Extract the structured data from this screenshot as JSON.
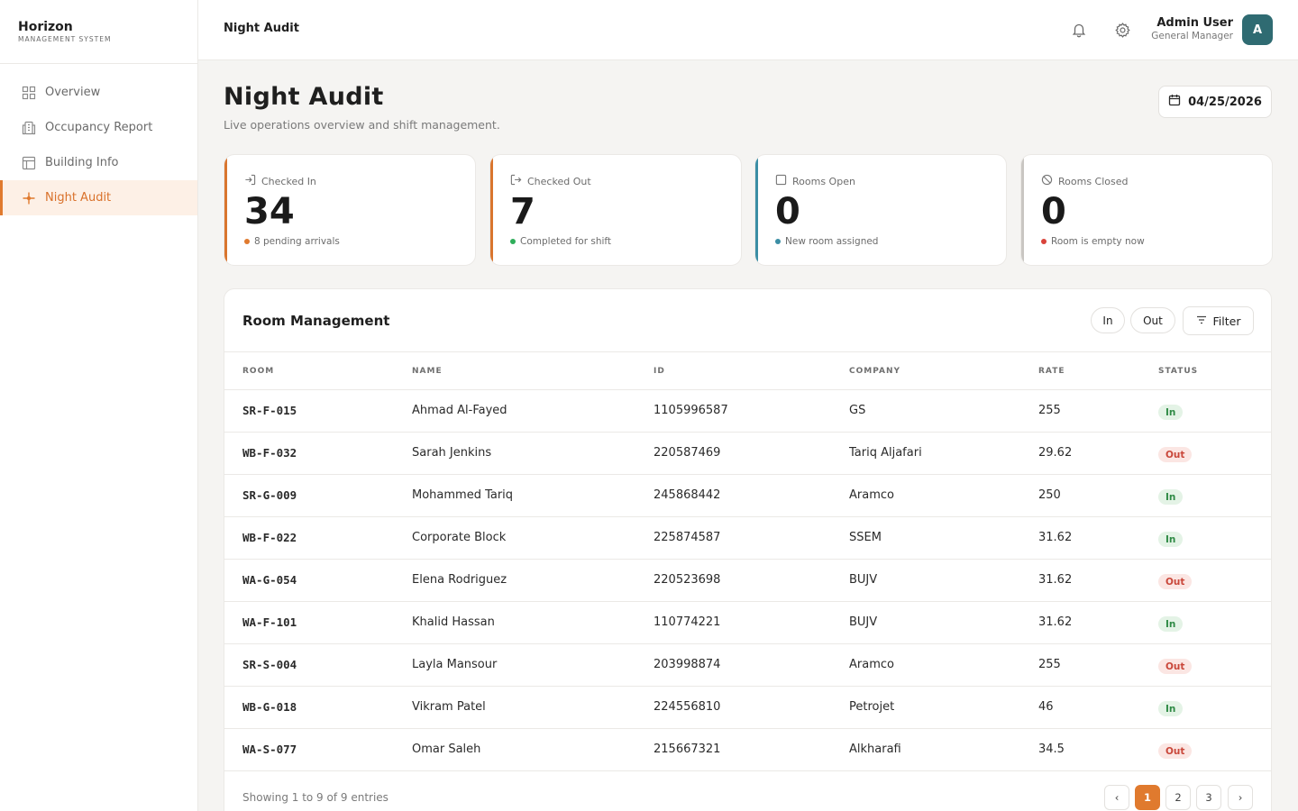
{
  "brand": {
    "name": "Horizon",
    "subtitle": "MANAGEMENT SYSTEM"
  },
  "sidebar": {
    "items": [
      {
        "label": "Overview",
        "icon": "grid-icon",
        "active": false
      },
      {
        "label": "Occupancy Report",
        "icon": "building-stack-icon",
        "active": false
      },
      {
        "label": "Building Info",
        "icon": "layout-icon",
        "active": false
      },
      {
        "label": "Night Audit",
        "icon": "sparkle-icon",
        "active": true
      }
    ]
  },
  "topbar": {
    "title": "Night Audit",
    "user": {
      "name": "Admin User",
      "role": "General Manager",
      "initial": "A"
    }
  },
  "page": {
    "title": "Night Audit",
    "subtitle": "Live operations overview and shift management.",
    "date": "04/25/2026"
  },
  "stats": [
    {
      "label": "Checked In",
      "value": "34",
      "note": "8 pending arrivals",
      "accent": "#d9752e",
      "dot": "#e07a2e"
    },
    {
      "label": "Checked Out",
      "value": "7",
      "note": "Completed for shift",
      "accent": "#d9752e",
      "dot": "#2eae5a"
    },
    {
      "label": "Rooms Open",
      "value": "0",
      "note": "New room assigned",
      "accent": "#3b8ea5",
      "dot": "#3b8ea5"
    },
    {
      "label": "Rooms Closed",
      "value": "0",
      "note": "Room is empty now",
      "accent": "#c9c6c2",
      "dot": "#d9433a"
    }
  ],
  "table": {
    "title": "Room Management",
    "toggle_in": "In",
    "toggle_out": "Out",
    "filter_label": "Filter",
    "columns": [
      "ROOM",
      "NAME",
      "ID",
      "COMPANY",
      "RATE",
      "STATUS"
    ],
    "rows": [
      {
        "room": "SR-F-015",
        "name": "Ahmad Al-Fayed",
        "id": "1105996587",
        "company": "GS",
        "rate": "255",
        "status": "In"
      },
      {
        "room": "WB-F-032",
        "name": "Sarah Jenkins",
        "id": "220587469",
        "company": "Tariq Aljafari",
        "rate": "29.62",
        "status": "Out"
      },
      {
        "room": "SR-G-009",
        "name": "Mohammed Tariq",
        "id": "245868442",
        "company": "Aramco",
        "rate": "250",
        "status": "In"
      },
      {
        "room": "WB-F-022",
        "name": "Corporate Block",
        "id": "225874587",
        "company": "SSEM",
        "rate": "31.62",
        "status": "In"
      },
      {
        "room": "WA-G-054",
        "name": "Elena Rodriguez",
        "id": "220523698",
        "company": "BUJV",
        "rate": "31.62",
        "status": "Out"
      },
      {
        "room": "WA-F-101",
        "name": "Khalid Hassan",
        "id": "110774221",
        "company": "BUJV",
        "rate": "31.62",
        "status": "In"
      },
      {
        "room": "SR-S-004",
        "name": "Layla Mansour",
        "id": "203998874",
        "company": "Aramco",
        "rate": "255",
        "status": "Out"
      },
      {
        "room": "WB-G-018",
        "name": "Vikram Patel",
        "id": "224556810",
        "company": "Petrojet",
        "rate": "46",
        "status": "In"
      },
      {
        "room": "WA-S-077",
        "name": "Omar Saleh",
        "id": "215667321",
        "company": "Alkharafi",
        "rate": "34.5",
        "status": "Out"
      }
    ],
    "footer": "Showing 1 to 9 of 9 entries",
    "pagination": {
      "prev": "‹",
      "pages": [
        "1",
        "2",
        "3"
      ],
      "current": "1",
      "next": "›"
    }
  }
}
